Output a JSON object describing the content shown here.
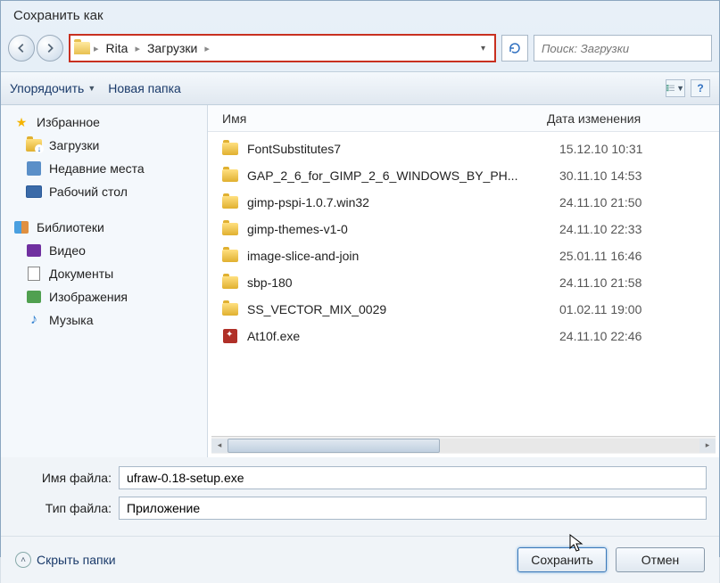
{
  "title": "Сохранить как",
  "breadcrumbs": [
    "Rita",
    "Загрузки"
  ],
  "search": {
    "placeholder": "Поиск: Загрузки"
  },
  "toolbar": {
    "organize": "Упорядочить",
    "newfolder": "Новая папка"
  },
  "sidebar": {
    "favorites": "Избранное",
    "downloads": "Загрузки",
    "recent": "Недавние места",
    "desktop": "Рабочий стол",
    "libraries": "Библиотеки",
    "videos": "Видео",
    "documents": "Документы",
    "pictures": "Изображения",
    "music": "Музыка"
  },
  "columns": {
    "name": "Имя",
    "date": "Дата изменения"
  },
  "files": [
    {
      "name": "FontSubstitutes7",
      "date": "15.12.10 10:31",
      "type": "folder"
    },
    {
      "name": "GAP_2_6_for_GIMP_2_6_WINDOWS_BY_PH...",
      "date": "30.11.10 14:53",
      "type": "folder"
    },
    {
      "name": "gimp-pspi-1.0.7.win32",
      "date": "24.11.10 21:50",
      "type": "folder"
    },
    {
      "name": "gimp-themes-v1-0",
      "date": "24.11.10 22:33",
      "type": "folder"
    },
    {
      "name": "image-slice-and-join",
      "date": "25.01.11 16:46",
      "type": "folder"
    },
    {
      "name": "sbp-180",
      "date": "24.11.10 21:58",
      "type": "folder"
    },
    {
      "name": "SS_VECTOR_MIX_0029",
      "date": "01.02.11 19:00",
      "type": "folder"
    },
    {
      "name": "At10f.exe",
      "date": "24.11.10 22:46",
      "type": "exe"
    }
  ],
  "filename": {
    "label": "Имя файла:",
    "value": "ufraw-0.18-setup.exe"
  },
  "filetype": {
    "label": "Тип файла:",
    "value": "Приложение"
  },
  "footer": {
    "hide": "Скрыть папки",
    "save": "Сохранить",
    "cancel": "Отмен"
  }
}
